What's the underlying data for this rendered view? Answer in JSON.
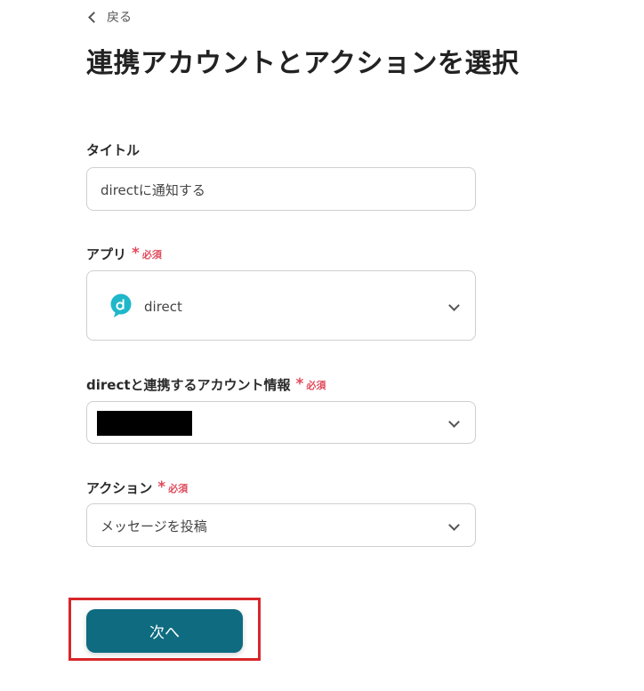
{
  "nav": {
    "back_label": "戻る"
  },
  "page": {
    "title": "連携アカウントとアクションを選択"
  },
  "required_label": "必須",
  "form": {
    "title_field": {
      "label": "タイトル",
      "value": "directに通知する"
    },
    "app_field": {
      "label": "アプリ",
      "value": "direct",
      "icon": "direct-app-icon"
    },
    "account_field": {
      "label": "directと連携するアカウント情報",
      "value_redacted": true
    },
    "action_field": {
      "label": "アクション",
      "value": "メッセージを投稿"
    }
  },
  "next_button": {
    "label": "次へ"
  },
  "colors": {
    "primary": "#0e6b80",
    "required": "#e04b5c",
    "highlight": "#d8262a",
    "app_icon": "#1fb7c9"
  }
}
